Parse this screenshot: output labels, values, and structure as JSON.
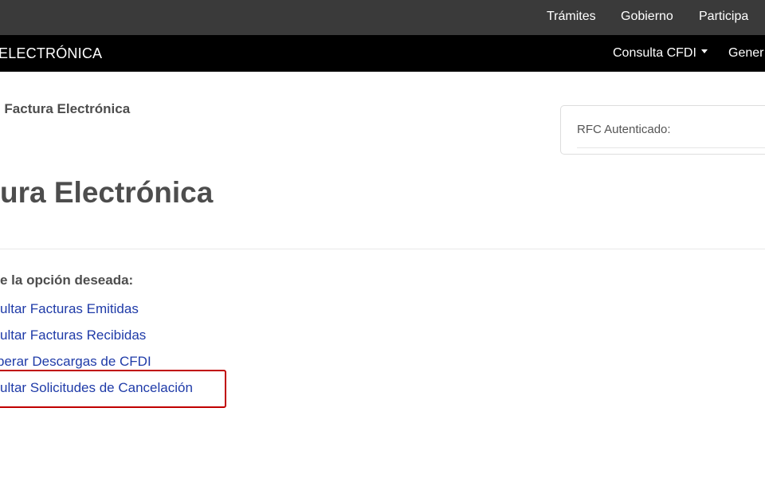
{
  "topbar": {
    "items": [
      "Trámites",
      "Gobierno",
      "Participa"
    ]
  },
  "navbar": {
    "brand": "ELECTRÓNICA",
    "links": [
      {
        "label": "Consulta CFDI",
        "has_caret": true
      },
      {
        "label": "Gener",
        "has_caret": false
      }
    ]
  },
  "breadcrumb": {
    "current": "Factura Electrónica",
    "separator_visible": "›"
  },
  "rfc_card": {
    "label": "RFC Autenticado:"
  },
  "page": {
    "title": "ura Electrónica",
    "prompt": "e la opción deseada:"
  },
  "options": [
    "ultar Facturas Emitidas",
    "ultar Facturas Recibidas",
    "perar Descargas de CFDI",
    "ultar Solicitudes de Cancelación"
  ],
  "colors": {
    "topbar_bg": "#3a3a3a",
    "navbar_bg": "#000000",
    "link": "#1f3ba8",
    "highlight_border": "#c00000",
    "text": "#4d4d4d"
  }
}
